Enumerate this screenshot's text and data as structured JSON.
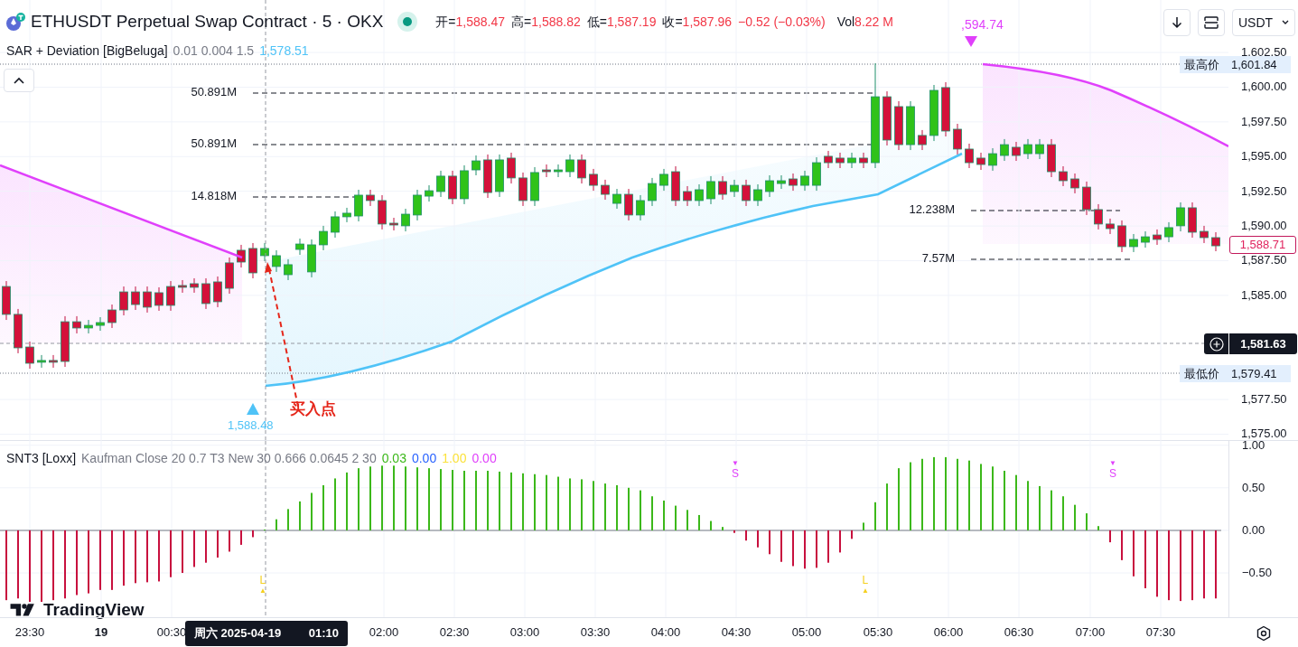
{
  "header": {
    "title": "ETHUSDT Perpetual Swap Contract · 5 · OKX",
    "market_open": true,
    "ohlc": [
      {
        "label": "开=",
        "value": "1,588.47"
      },
      {
        "label": "高=",
        "value": "1,588.82"
      },
      {
        "label": "低=",
        "value": "1,587.19"
      },
      {
        "label": "收=",
        "value": "1,587.96"
      }
    ],
    "change": "−0.52 (−0.03%)",
    "volume_label": "Vol",
    "volume": "8.22 M",
    "currency": "USDT"
  },
  "indicator": {
    "name": "SAR + Deviation [BigBeluga]",
    "params": "0.01 0.004 1.5",
    "value": "1,578.51"
  },
  "price_chart": {
    "chart_data": {
      "type": "candlestick",
      "ylim": [
        1574.51,
        1606.28
      ],
      "grid": true,
      "yticks": [
        {
          "value": 1602.5,
          "label": "1,602.50"
        },
        {
          "value": 1600,
          "label": "1,600.00"
        },
        {
          "value": 1597.5,
          "label": "1,597.50"
        },
        {
          "value": 1595,
          "label": "1,595.00"
        },
        {
          "value": 1592.5,
          "label": "1,592.50"
        },
        {
          "value": 1590,
          "label": "1,590.00"
        },
        {
          "value": 1587.5,
          "label": "1,587.50"
        },
        {
          "value": 1585,
          "label": "1,585.00"
        },
        {
          "value": 1577.5,
          "label": "1,577.50"
        },
        {
          "value": 1575,
          "label": "1,575.00"
        }
      ],
      "ohlc": [
        [
          1585.64,
          1586.03,
          1583.23,
          1583.63
        ],
        [
          1583.63,
          1584.02,
          1580.83,
          1581.22
        ],
        [
          1581.28,
          1581.67,
          1579.72,
          1580.11
        ],
        [
          1580.18,
          1580.7,
          1579.79,
          1580.31
        ],
        [
          1580.31,
          1580.7,
          1579.79,
          1580.18
        ],
        [
          1583.1,
          1583.5,
          1579.85,
          1580.24
        ],
        [
          1583.1,
          1583.5,
          1582.26,
          1582.65
        ],
        [
          1582.65,
          1583.23,
          1582.26,
          1582.84
        ],
        [
          1582.84,
          1583.43,
          1582.45,
          1583.04
        ],
        [
          1583.95,
          1584.34,
          1582.65,
          1583.04
        ],
        [
          1585.25,
          1585.64,
          1583.56,
          1583.95
        ],
        [
          1585.25,
          1585.64,
          1583.95,
          1584.34
        ],
        [
          1585.25,
          1585.64,
          1583.76,
          1584.15
        ],
        [
          1585.19,
          1585.58,
          1583.89,
          1584.28
        ],
        [
          1585.64,
          1586.03,
          1583.89,
          1584.28
        ],
        [
          1585.71,
          1586.1,
          1585.19,
          1585.58
        ],
        [
          1585.84,
          1586.23,
          1585.19,
          1585.58
        ],
        [
          1585.84,
          1586.23,
          1584.02,
          1584.41
        ],
        [
          1585.97,
          1586.36,
          1584.15,
          1584.54
        ],
        [
          1587.34,
          1587.73,
          1585.12,
          1585.51
        ],
        [
          1588.25,
          1588.64,
          1587.01,
          1587.4
        ],
        [
          1588.38,
          1588.77,
          1586.23,
          1586.62
        ],
        [
          1587.86,
          1588.77,
          1587.47,
          1588.38
        ],
        [
          1587.08,
          1588.25,
          1586.69,
          1587.86
        ],
        [
          1586.49,
          1587.6,
          1586.1,
          1587.21
        ],
        [
          1588.31,
          1589.09,
          1587.92,
          1588.7
        ],
        [
          1586.69,
          1589.03,
          1586.3,
          1588.64
        ],
        [
          1588.64,
          1590.01,
          1588.25,
          1589.61
        ],
        [
          1589.55,
          1591.05,
          1589.16,
          1590.66
        ],
        [
          1590.66,
          1591.31,
          1590.27,
          1590.92
        ],
        [
          1590.72,
          1592.61,
          1590.33,
          1592.22
        ],
        [
          1592.22,
          1592.61,
          1591.44,
          1591.83
        ],
        [
          1591.83,
          1592.22,
          1589.75,
          1590.14
        ],
        [
          1590.2,
          1590.59,
          1589.68,
          1590.07
        ],
        [
          1590.01,
          1591.24,
          1589.61,
          1590.85
        ],
        [
          1590.79,
          1592.61,
          1590.4,
          1592.22
        ],
        [
          1592.15,
          1592.93,
          1591.76,
          1592.54
        ],
        [
          1592.48,
          1593.98,
          1592.09,
          1593.59
        ],
        [
          1593.59,
          1593.98,
          1591.57,
          1591.96
        ],
        [
          1591.96,
          1594.37,
          1591.57,
          1593.98
        ],
        [
          1594.04,
          1595.08,
          1593.65,
          1594.69
        ],
        [
          1594.76,
          1595.15,
          1592.02,
          1592.41
        ],
        [
          1592.48,
          1595.15,
          1592.09,
          1594.76
        ],
        [
          1594.89,
          1595.28,
          1593.06,
          1593.46
        ],
        [
          1593.46,
          1593.85,
          1591.44,
          1591.83
        ],
        [
          1591.83,
          1594.24,
          1591.44,
          1593.85
        ],
        [
          1594.04,
          1594.43,
          1593.52,
          1593.91
        ],
        [
          1593.91,
          1594.43,
          1593.52,
          1594.04
        ],
        [
          1593.91,
          1595.15,
          1593.52,
          1594.76
        ],
        [
          1594.76,
          1595.15,
          1593.06,
          1593.46
        ],
        [
          1593.72,
          1594.11,
          1592.54,
          1592.93
        ],
        [
          1592.93,
          1593.33,
          1591.89,
          1592.28
        ],
        [
          1591.63,
          1592.67,
          1591.24,
          1592.28
        ],
        [
          1592.28,
          1592.67,
          1590.4,
          1590.79
        ],
        [
          1590.79,
          1592.22,
          1590.4,
          1591.83
        ],
        [
          1591.83,
          1593.46,
          1591.44,
          1593.06
        ],
        [
          1592.93,
          1594.11,
          1592.54,
          1593.72
        ],
        [
          1593.91,
          1594.3,
          1591.44,
          1591.83
        ],
        [
          1592.48,
          1592.87,
          1591.44,
          1591.83
        ],
        [
          1591.83,
          1593.0,
          1591.44,
          1592.61
        ],
        [
          1591.96,
          1593.59,
          1591.57,
          1593.2
        ],
        [
          1593.2,
          1593.59,
          1591.89,
          1592.28
        ],
        [
          1592.48,
          1593.33,
          1592.09,
          1592.93
        ],
        [
          1592.93,
          1593.33,
          1591.44,
          1591.83
        ],
        [
          1591.83,
          1593.0,
          1591.44,
          1592.61
        ],
        [
          1592.48,
          1593.65,
          1592.09,
          1593.26
        ],
        [
          1593.06,
          1593.65,
          1592.67,
          1593.26
        ],
        [
          1593.39,
          1593.78,
          1592.54,
          1592.93
        ],
        [
          1592.93,
          1593.98,
          1592.54,
          1593.59
        ],
        [
          1592.93,
          1594.95,
          1592.54,
          1594.56
        ],
        [
          1595.02,
          1595.41,
          1594.17,
          1594.56
        ],
        [
          1594.89,
          1595.28,
          1594.17,
          1594.56
        ],
        [
          1594.56,
          1595.28,
          1594.17,
          1594.89
        ],
        [
          1594.89,
          1595.28,
          1594.17,
          1594.56
        ],
        [
          1594.56,
          1601.72,
          1594.17,
          1599.31
        ],
        [
          1599.31,
          1599.7,
          1595.8,
          1596.19
        ],
        [
          1598.6,
          1598.99,
          1595.47,
          1595.86
        ],
        [
          1595.86,
          1598.99,
          1595.47,
          1598.6
        ],
        [
          1596.52,
          1596.91,
          1595.47,
          1595.86
        ],
        [
          1596.52,
          1600.16,
          1596.12,
          1599.77
        ],
        [
          1599.97,
          1600.36,
          1596.45,
          1596.84
        ],
        [
          1596.97,
          1597.36,
          1595.15,
          1595.54
        ],
        [
          1595.54,
          1595.93,
          1594.17,
          1594.56
        ],
        [
          1594.89,
          1595.28,
          1594.04,
          1594.43
        ],
        [
          1594.37,
          1595.6,
          1593.98,
          1595.21
        ],
        [
          1595.08,
          1596.26,
          1594.69,
          1595.86
        ],
        [
          1595.67,
          1596.06,
          1594.69,
          1595.08
        ],
        [
          1595.21,
          1596.26,
          1594.82,
          1595.86
        ],
        [
          1595.21,
          1596.26,
          1594.82,
          1595.86
        ],
        [
          1595.86,
          1596.26,
          1593.52,
          1593.91
        ],
        [
          1593.91,
          1594.3,
          1592.87,
          1593.26
        ],
        [
          1593.39,
          1593.78,
          1592.35,
          1592.74
        ],
        [
          1592.8,
          1593.2,
          1590.79,
          1591.18
        ],
        [
          1591.18,
          1591.57,
          1589.75,
          1590.14
        ],
        [
          1590.14,
          1590.53,
          1589.42,
          1589.81
        ],
        [
          1590.01,
          1590.4,
          1588.12,
          1588.51
        ],
        [
          1588.51,
          1589.42,
          1588.12,
          1589.03
        ],
        [
          1588.83,
          1589.61,
          1588.44,
          1589.22
        ],
        [
          1589.35,
          1589.75,
          1588.64,
          1589.03
        ],
        [
          1589.22,
          1590.27,
          1588.83,
          1589.88
        ],
        [
          1590.01,
          1591.7,
          1589.61,
          1591.31
        ],
        [
          1591.31,
          1591.7,
          1589.16,
          1589.55
        ],
        [
          1589.61,
          1590.01,
          1588.77,
          1589.16
        ],
        [
          1589.16,
          1589.55,
          1588.18,
          1588.57
        ]
      ]
    }
  },
  "volume_levels": [
    {
      "label": "50.891M"
    },
    {
      "label": "50.891M"
    },
    {
      "label": "14.818M"
    },
    {
      "label": "12.238M"
    },
    {
      "label": "7.57M"
    }
  ],
  "signals_main": [
    {
      "kind": "buy",
      "text": "1,588.48"
    },
    {
      "kind": "sell",
      "text": ",594.74"
    }
  ],
  "annotation": "买入点",
  "price_axis": {
    "high": {
      "label": "最高价",
      "value": "1,601.84"
    },
    "last": "1,588.71",
    "crosshair": "1,581.63",
    "low": {
      "label": "最低价",
      "value": "1,579.41"
    }
  },
  "oscillator": {
    "name": "SNT3 [Loxx]",
    "params": "Kaufman Close 20 0.7 T3 New 30 0.666 0.0645 2 30",
    "readings": [
      {
        "value": "0.03",
        "color": "#3cb81a"
      },
      {
        "value": "0.00",
        "color": "#2962ff"
      },
      {
        "value": "1.00",
        "color": "#fbe23b"
      },
      {
        "value": "0.00",
        "color": "#e040fb"
      }
    ],
    "signals": [
      {
        "kind": "long",
        "text": "L",
        "marker": "▲"
      },
      {
        "kind": "short",
        "text": "S",
        "marker": "▼"
      },
      {
        "kind": "long",
        "text": "L",
        "marker": "▲"
      },
      {
        "kind": "short",
        "text": "S",
        "marker": "▼"
      }
    ],
    "chart_data": {
      "type": "bar",
      "ylim": [
        -1.02,
        1.05
      ],
      "grid": true,
      "yticks": [
        {
          "value": 1,
          "label": "1.00"
        },
        {
          "value": 0.5,
          "label": "0.50"
        },
        {
          "value": 0,
          "label": "0.00"
        },
        {
          "value": -0.5,
          "label": "−0.50"
        }
      ],
      "values": [
        -0.82,
        -0.8,
        -0.84,
        -0.84,
        -0.82,
        -0.8,
        -0.76,
        -0.74,
        -0.7,
        -0.7,
        -0.65,
        -0.62,
        -0.61,
        -0.6,
        -0.55,
        -0.5,
        -0.43,
        -0.38,
        -0.32,
        -0.25,
        -0.17,
        -0.08,
        0.01,
        0.13,
        0.25,
        0.34,
        0.44,
        0.53,
        0.61,
        0.68,
        0.73,
        0.75,
        0.76,
        0.76,
        0.75,
        0.74,
        0.73,
        0.72,
        0.71,
        0.7,
        0.7,
        0.7,
        0.69,
        0.68,
        0.67,
        0.66,
        0.65,
        0.63,
        0.61,
        0.6,
        0.58,
        0.55,
        0.53,
        0.5,
        0.47,
        0.4,
        0.35,
        0.29,
        0.24,
        0.18,
        0.11,
        0.04,
        -0.03,
        -0.12,
        -0.2,
        -0.28,
        -0.37,
        -0.42,
        -0.45,
        -0.44,
        -0.38,
        -0.26,
        -0.1,
        0.09,
        0.33,
        0.55,
        0.73,
        0.8,
        0.84,
        0.86,
        0.86,
        0.84,
        0.82,
        0.78,
        0.75,
        0.7,
        0.65,
        0.58,
        0.52,
        0.47,
        0.4,
        0.3,
        0.2,
        0.05,
        -0.14,
        -0.35,
        -0.54,
        -0.68,
        -0.78,
        -0.82,
        -0.83,
        -0.82,
        -0.8,
        -0.8
      ]
    }
  },
  "time_axis": {
    "ticks": [
      {
        "label": "23:30",
        "bold": false
      },
      {
        "label": "19",
        "bold": true
      },
      {
        "label": "00:30",
        "bold": false
      },
      {
        "label": "02:00",
        "bold": false
      },
      {
        "label": "02:30",
        "bold": false
      },
      {
        "label": "03:00",
        "bold": false
      },
      {
        "label": "03:30",
        "bold": false
      },
      {
        "label": "04:00",
        "bold": false
      },
      {
        "label": "04:30",
        "bold": false
      },
      {
        "label": "05:00",
        "bold": false
      },
      {
        "label": "05:30",
        "bold": false
      },
      {
        "label": "06:00",
        "bold": false
      },
      {
        "label": "06:30",
        "bold": false
      },
      {
        "label": "07:00",
        "bold": false
      },
      {
        "label": "07:30",
        "bold": false
      }
    ],
    "crosshair_date": "周六 2025-04-19",
    "crosshair_time": "01:10"
  },
  "branding": "TradingView"
}
